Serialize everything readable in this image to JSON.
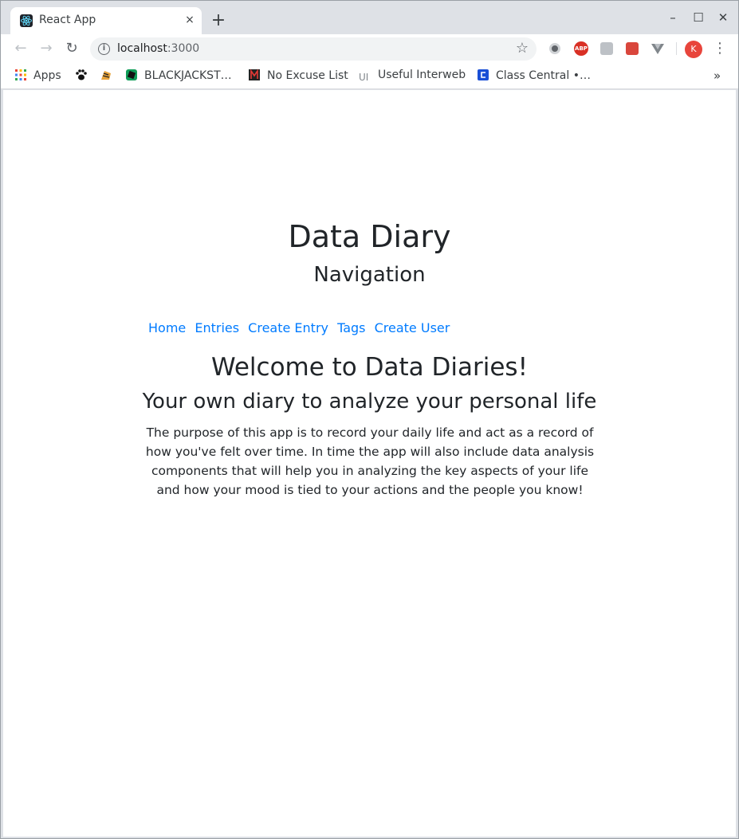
{
  "browser": {
    "tab": {
      "title": "React App",
      "close_glyph": "×",
      "favicon": "react-icon"
    },
    "new_tab_glyph": "+",
    "window_controls": {
      "minimize": "–",
      "maximize": "☐",
      "close": "✕"
    },
    "toolbar": {
      "back_glyph": "←",
      "forward_glyph": "→",
      "reload_glyph": "↻",
      "url_host": "localhost",
      "url_port": ":3000",
      "star_glyph": "☆",
      "avatar_letter": "K",
      "menu_glyph": "⋮",
      "extension_abp_label": "ABP"
    },
    "bookmarks": [
      {
        "label": "Apps",
        "icon": "apps-grid-icon"
      },
      {
        "label": "",
        "icon": "paw-icon"
      },
      {
        "label": "",
        "icon": "tiger-icon"
      },
      {
        "label": "BLACKJACKST…",
        "icon": "blackjack-icon"
      },
      {
        "label": "No Excuse List",
        "icon": "no-excuse-icon"
      },
      {
        "label": "Useful Interweb",
        "icon": "ui-icon",
        "icon_text": "UI"
      },
      {
        "label": "Class Central •…",
        "icon": "class-central-icon"
      }
    ],
    "bookmarks_overflow": "»"
  },
  "page": {
    "title": "Data Diary",
    "subtitle": "Navigation",
    "nav_links": [
      "Home",
      "Entries",
      "Create Entry",
      "Tags",
      "Create User"
    ],
    "welcome_heading": "Welcome to Data Diaries!",
    "tagline": "Your own diary to analyze your personal life",
    "description": "The purpose of this app is to record your daily life and act as a record of how you've felt over time. In time the app will also include data analysis components that will help you in analyzing the key aspects of your life and how your mood is tied to your actions and the people you know!"
  },
  "colors": {
    "link": "#007bff",
    "text": "#212529",
    "chrome_frame": "#dee1e6",
    "avatar_bg": "#e8453c"
  }
}
